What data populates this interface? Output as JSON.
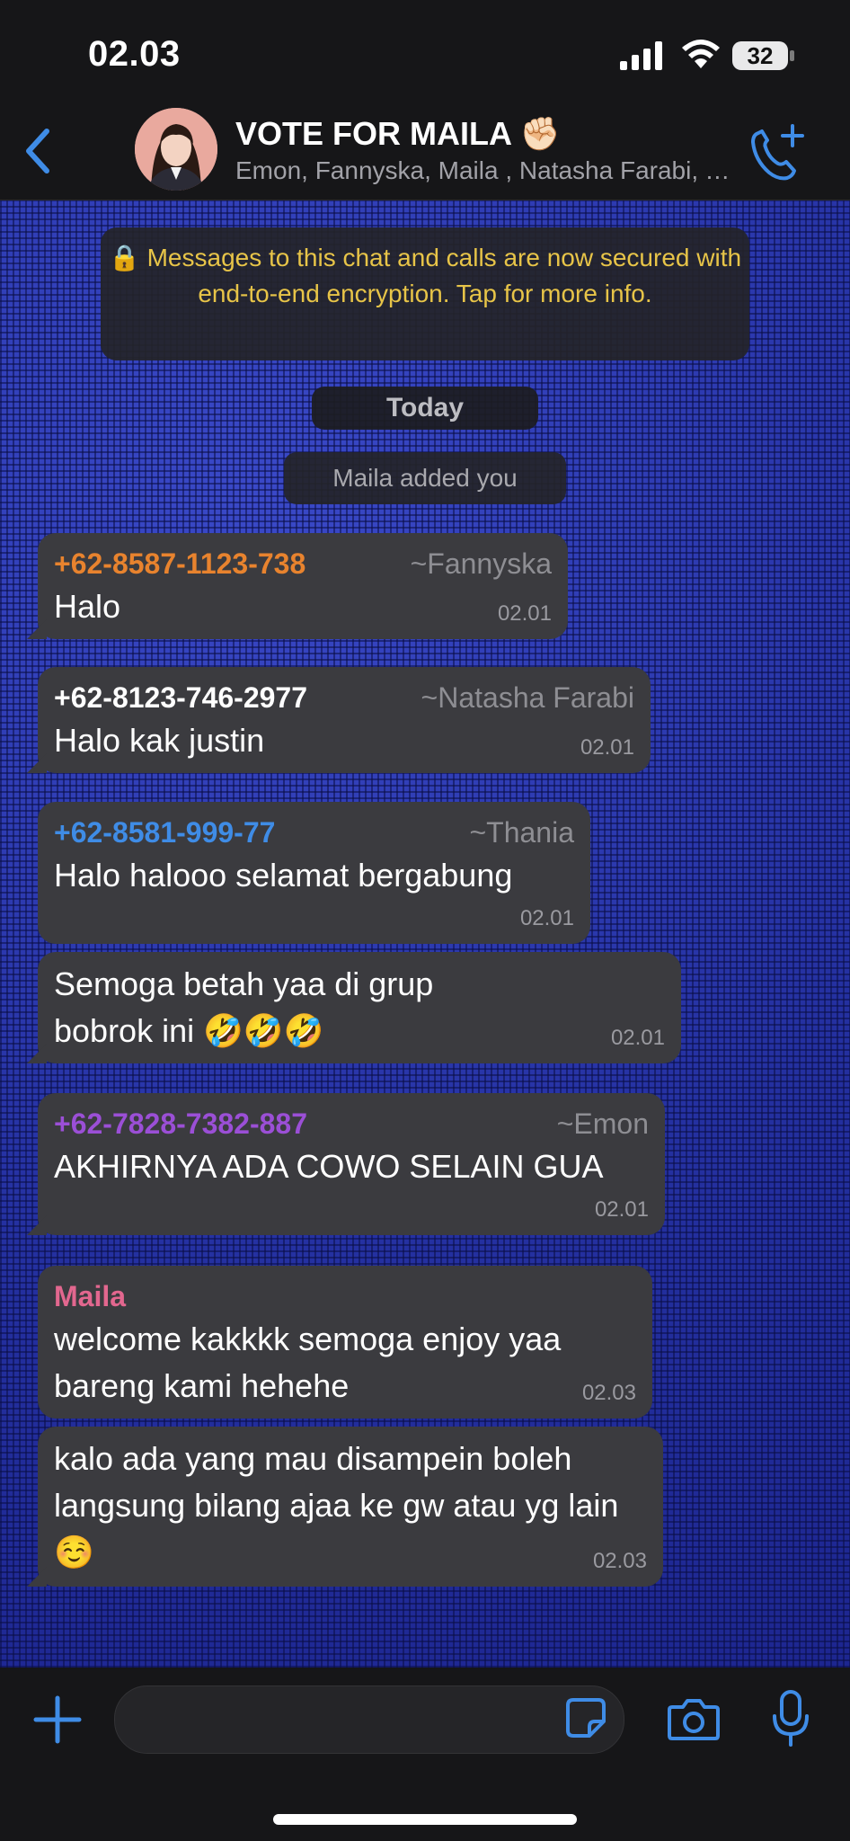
{
  "status_bar": {
    "time": "02.03",
    "battery": "32"
  },
  "header": {
    "title": "VOTE FOR MAILA ✊🏻",
    "subtitle": "Emon, Fannyska, Maila , Natasha Farabi, Thania, You"
  },
  "chat": {
    "encryption_notice": "🔒 Messages to this chat and calls are now secured with end-to-end encryption. Tap for more info.",
    "date_label": "Today",
    "system_message": "Maila added you",
    "messages": [
      {
        "sender": "+62-8587-1123-738",
        "pushname": "~Fannyska",
        "text": "Halo",
        "time": "02.01",
        "sender_color": "#e8832e"
      },
      {
        "sender": "+62-8123-746-2977",
        "pushname": "~Natasha Farabi",
        "text": "Halo kak justin",
        "time": "02.01",
        "sender_color": "#ffffff"
      },
      {
        "sender": "+62-8581-999-77",
        "pushname": "~Thania",
        "text": "Halo halooo selamat bergabung",
        "time": "02.01",
        "sender_color": "#3f8ce6"
      },
      {
        "sender": "",
        "pushname": "",
        "text": "Semoga betah yaa di grup bobrok ini 🤣🤣🤣",
        "time": "02.01",
        "sender_color": ""
      },
      {
        "sender": "+62-7828-7382-887",
        "pushname": "~Emon",
        "text": "AKHIRNYA ADA COWO SELAIN GUA",
        "time": "02.01",
        "sender_color": "#9b4fd6"
      },
      {
        "sender": "Maila",
        "pushname": "",
        "text": "welcome kakkkk semoga enjoy yaa bareng kami hehehe",
        "time": "02.03",
        "sender_color": "#e2678f"
      },
      {
        "sender": "",
        "pushname": "",
        "text": "kalo ada yang mau disampein boleh langsung bilang ajaa ke gw atau yg lain ☺️",
        "time": "02.03",
        "sender_color": ""
      }
    ]
  },
  "icons": {
    "back": "chevron-left-icon",
    "call": "phone-add-icon",
    "plus": "plus-icon",
    "sticker": "sticker-icon",
    "camera": "camera-icon",
    "mic": "microphone-icon"
  },
  "colors": {
    "accent": "#3f8ce6",
    "encryption_text": "#e7c448",
    "bubble": "#3b3b3f"
  }
}
